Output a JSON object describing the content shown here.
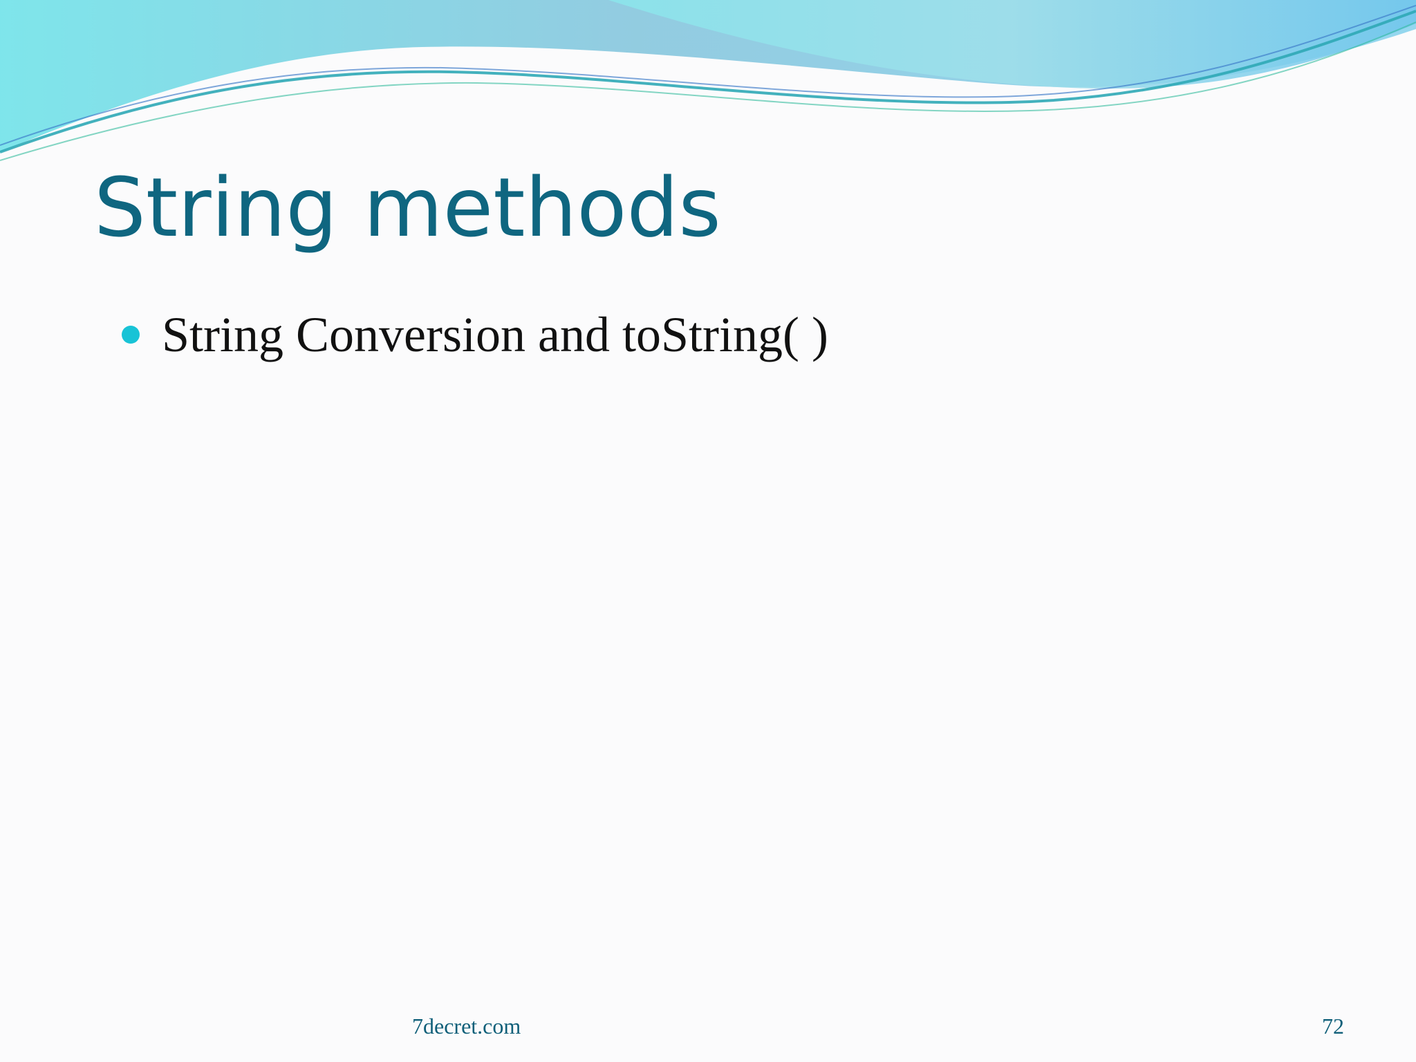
{
  "slide": {
    "title": "String methods",
    "bullets": [
      "String Conversion and toString( )"
    ],
    "footer": {
      "site": "7decret.com",
      "page_number": "72"
    }
  },
  "colors": {
    "title": "#0f6680",
    "bullet_marker": "#18c3d6",
    "body_text": "#111111",
    "footer_text": "#0f5f79"
  }
}
